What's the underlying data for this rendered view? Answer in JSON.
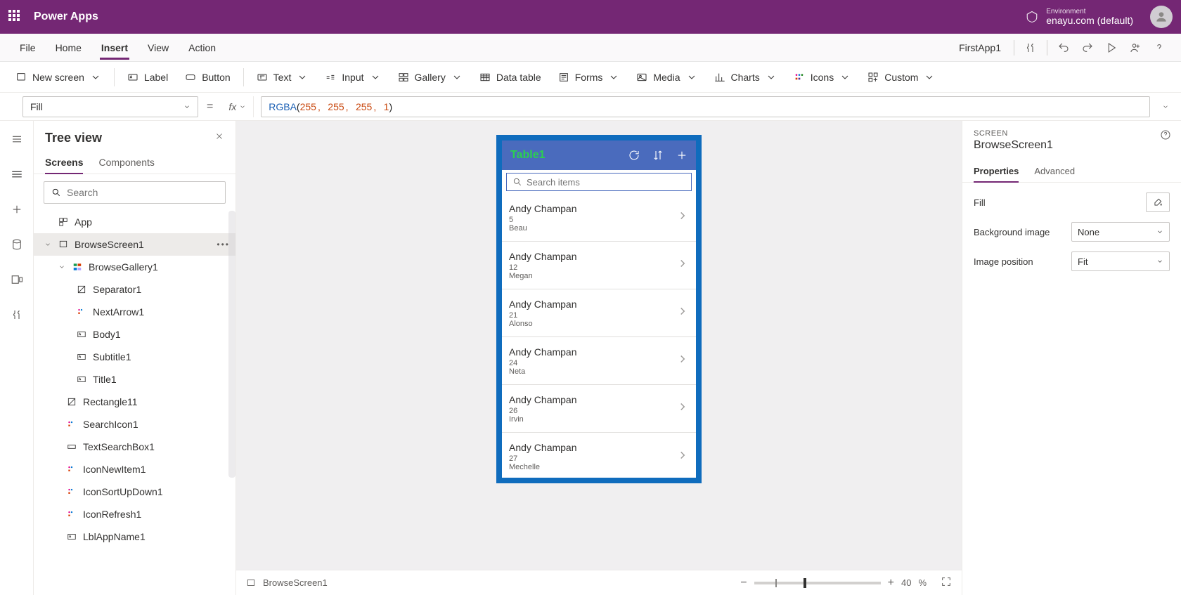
{
  "brand": "Power Apps",
  "environment": {
    "label": "Environment",
    "name": "enayu.com (default)"
  },
  "menu": {
    "items": [
      "File",
      "Home",
      "Insert",
      "View",
      "Action"
    ],
    "active": "Insert",
    "appName": "FirstApp1"
  },
  "ribbon": {
    "newScreen": "New screen",
    "label": "Label",
    "button": "Button",
    "text": "Text",
    "input": "Input",
    "gallery": "Gallery",
    "dataTable": "Data table",
    "forms": "Forms",
    "media": "Media",
    "charts": "Charts",
    "icons": "Icons",
    "custom": "Custom"
  },
  "formula": {
    "property": "Fill",
    "fn": "RGBA",
    "args": [
      "255",
      "255",
      "255",
      "1"
    ]
  },
  "tree": {
    "title": "Tree view",
    "tabs": {
      "screens": "Screens",
      "components": "Components"
    },
    "searchPlaceholder": "Search",
    "nodes": {
      "app": "App",
      "browseScreen": "BrowseScreen1",
      "browseGallery": "BrowseGallery1",
      "separator": "Separator1",
      "nextArrow": "NextArrow1",
      "body": "Body1",
      "subtitle": "Subtitle1",
      "title": "Title1",
      "rectangle": "Rectangle11",
      "searchIcon": "SearchIcon1",
      "textSearchBox": "TextSearchBox1",
      "iconNewItem": "IconNewItem1",
      "iconSortUpDown": "IconSortUpDown1",
      "iconRefresh": "IconRefresh1",
      "lblAppName": "LblAppName1"
    }
  },
  "preview": {
    "headerTitle": "Table1",
    "searchPlaceholder": "Search items",
    "items": [
      {
        "title": "Andy Champan",
        "sub": "5",
        "body": "Beau"
      },
      {
        "title": "Andy Champan",
        "sub": "12",
        "body": "Megan"
      },
      {
        "title": "Andy Champan",
        "sub": "21",
        "body": "Alonso"
      },
      {
        "title": "Andy Champan",
        "sub": "24",
        "body": "Neta"
      },
      {
        "title": "Andy Champan",
        "sub": "26",
        "body": "Irvin"
      },
      {
        "title": "Andy Champan",
        "sub": "27",
        "body": "Mechelle"
      }
    ]
  },
  "canvasFooter": {
    "breadcrumb": "BrowseScreen1",
    "zoomPct": "40",
    "pctSuffix": "%"
  },
  "props": {
    "sectionLabel": "SCREEN",
    "name": "BrowseScreen1",
    "tabs": {
      "properties": "Properties",
      "advanced": "Advanced"
    },
    "rows": {
      "fill": "Fill",
      "bgImage": "Background image",
      "bgImageValue": "None",
      "imgPos": "Image position",
      "imgPosValue": "Fit"
    }
  }
}
